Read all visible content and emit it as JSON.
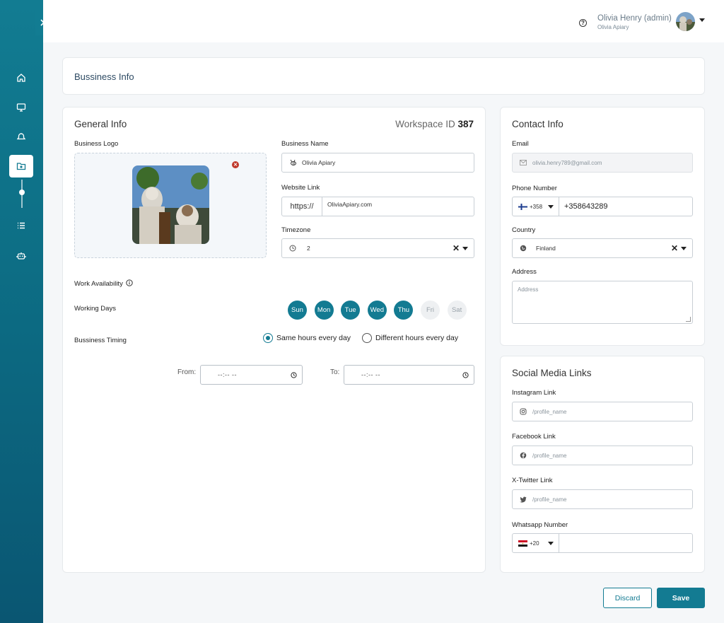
{
  "header": {
    "user_name": "Olivia Henry (admin)",
    "user_org": "Olivia Apiary"
  },
  "page_title": "Bussiness Info",
  "general": {
    "title": "General Info",
    "workspace_label": "Workspace ID",
    "workspace_id": "387",
    "logo_label": "Business Logo",
    "business_name_label": "Business Name",
    "business_name_value": "Olivia Apiary",
    "website_label": "Website Link",
    "website_prefix": "https://",
    "website_value": "OliviaApiary.com",
    "timezone_label": "Timezone",
    "timezone_value": "2",
    "work_availability_label": "Work Availability",
    "working_days_label": "Working Days",
    "days": [
      {
        "label": "Sun",
        "active": true
      },
      {
        "label": "Mon",
        "active": true
      },
      {
        "label": "Tue",
        "active": true
      },
      {
        "label": "Wed",
        "active": true
      },
      {
        "label": "Thu",
        "active": true
      },
      {
        "label": "Fri",
        "active": false
      },
      {
        "label": "Sat",
        "active": false
      }
    ],
    "timing_label": "Bussiness Timing",
    "same_hours_label": "Same hours every day",
    "different_hours_label": "Different hours every day",
    "from_label": "From:",
    "from_value": "--:-- --",
    "to_label": "To:",
    "to_value": "--:-- --"
  },
  "contact": {
    "title": "Contact Info",
    "email_label": "Email",
    "email_value": "olivia.henry789@gmail.com",
    "phone_label": "Phone Number",
    "phone_code": "+358",
    "phone_value": "+358643289",
    "country_label": "Country",
    "country_value": "Finland",
    "address_label": "Address",
    "address_placeholder": "Address"
  },
  "social": {
    "title": "Social Media Links",
    "instagram_label": "Instagram Link",
    "instagram_placeholder": "/profile_name",
    "facebook_label": "Facebook Link",
    "facebook_placeholder": "/profile_name",
    "twitter_label": "X-Twitter Link",
    "twitter_placeholder": "/profile_name",
    "whatsapp_label": "Whatsapp Number",
    "whatsapp_code": "+20"
  },
  "actions": {
    "discard_label": "Discard",
    "save_label": "Save"
  },
  "colors": {
    "accent": "#137b92",
    "sidebar_top": "#127c92",
    "sidebar_bottom": "#0a5672",
    "error": "#c0392b"
  }
}
